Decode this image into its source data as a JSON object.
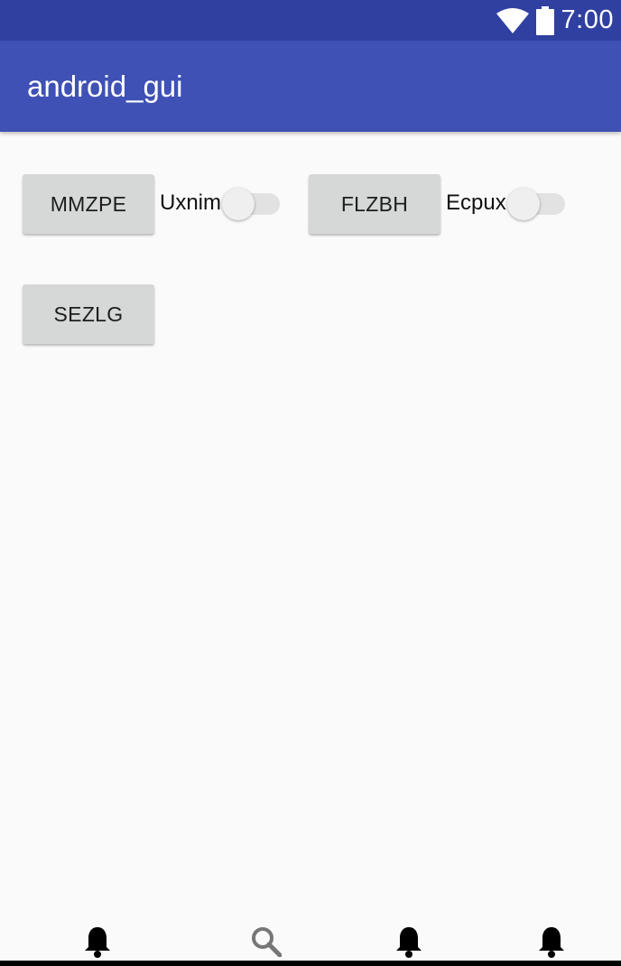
{
  "status_bar": {
    "time": "7:00",
    "icons": [
      "wifi-icon",
      "battery-icon"
    ],
    "color": "#3040a0"
  },
  "app_bar": {
    "title": "android_gui",
    "color": "#3f51b5"
  },
  "content": {
    "buttons": [
      "MMZPE",
      "FLZBH",
      "SEZLG"
    ],
    "switches": [
      {
        "label": "Uxnim",
        "checked": false
      },
      {
        "label": "Ecpux",
        "checked": false
      }
    ]
  },
  "bottom_nav": {
    "items": [
      "bell-icon",
      "search-icon",
      "bell-icon",
      "bell-icon"
    ]
  }
}
